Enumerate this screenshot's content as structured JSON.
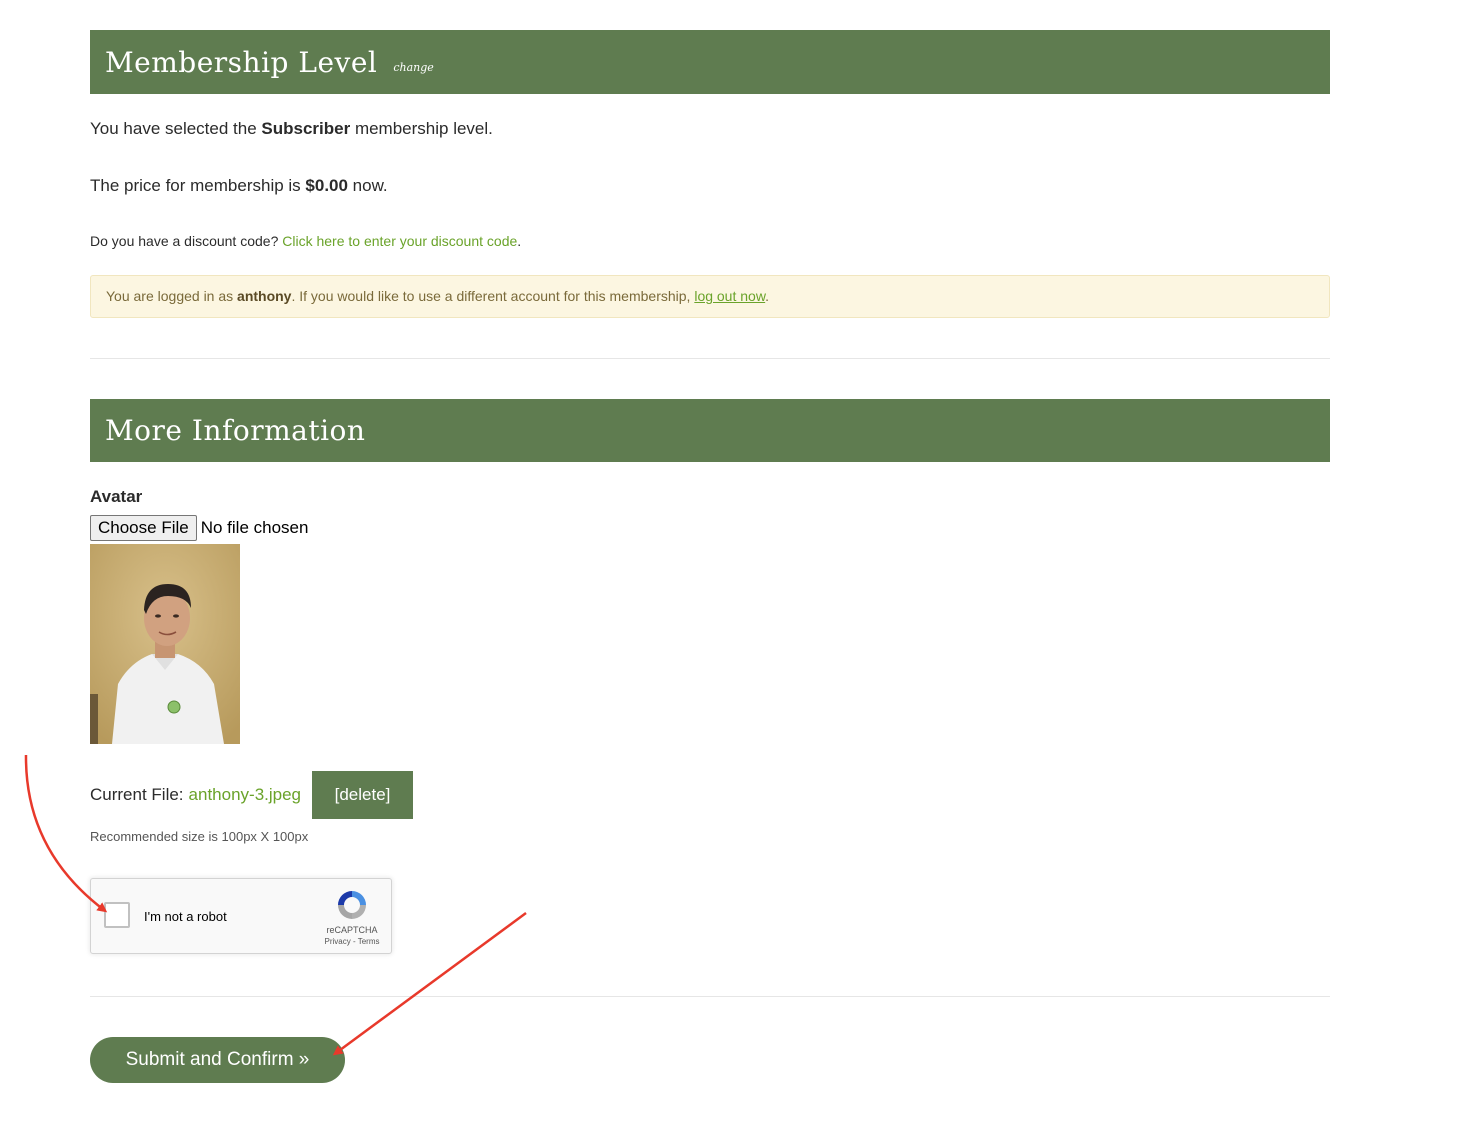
{
  "membership": {
    "title": "Membership Level",
    "change_label": "change",
    "selected_prefix": "You have selected the ",
    "level_name": "Subscriber",
    "selected_suffix": " membership level.",
    "price_prefix": "The price for membership is ",
    "price": "$0.00",
    "price_suffix": " now.",
    "discount_question": "Do you have a discount code? ",
    "discount_link": "Click here to enter your discount code",
    "discount_end": "."
  },
  "notice": {
    "prefix": "You are logged in as ",
    "username": "anthony",
    "middle": ". If you would like to use a different account for this membership, ",
    "logout_link": "log out now",
    "end": "."
  },
  "more_info": {
    "title": "More Information",
    "avatar_label": "Avatar",
    "choose_file_label": "Choose File",
    "no_file_text": "No file chosen",
    "current_file_label": "Current File:",
    "current_file_name": "anthony-3.jpeg",
    "delete_label": "[delete]",
    "recommended_size": "Recommended size is 100px X 100px"
  },
  "recaptcha": {
    "checkbox_label": "I'm not a robot",
    "brand": "reCAPTCHA",
    "terms": "Privacy - Terms"
  },
  "submit": {
    "label": "Submit and Confirm »"
  },
  "colors": {
    "header_green": "#5f7c50",
    "link_green": "#6aa32a",
    "notice_bg": "#fcf6e1",
    "arrow_red": "#e8392b"
  }
}
